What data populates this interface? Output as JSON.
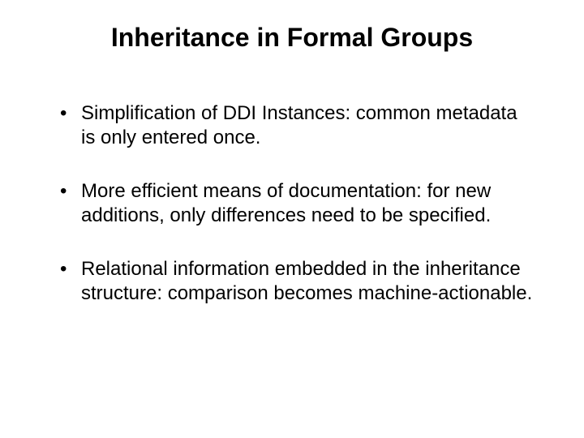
{
  "slide": {
    "title": "Inheritance in Formal Groups",
    "bullets": [
      "Simplification of DDI Instances: common metadata is only entered once.",
      "More efficient means of documentation: for new additions, only differences need to be specified.",
      "Relational information embedded in the inheritance structure: comparison becomes machine-actionable."
    ]
  }
}
